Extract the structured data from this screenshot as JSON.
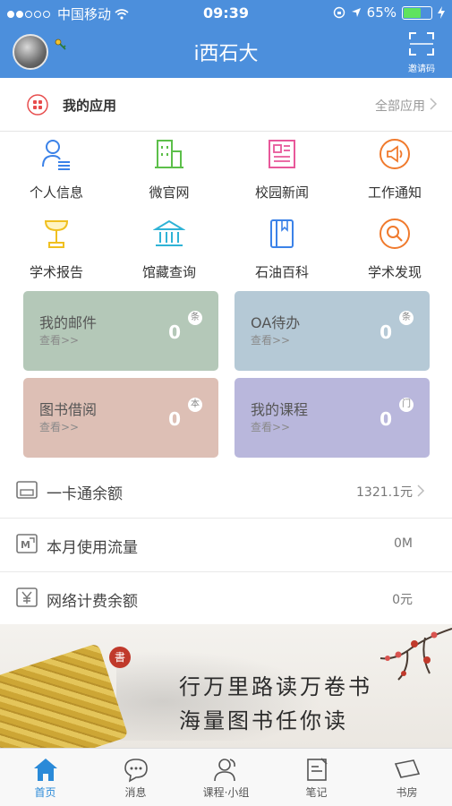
{
  "status_bar": {
    "carrier": "中国移动",
    "time": "09:39",
    "battery": "65%",
    "battery_level": 0.65
  },
  "header": {
    "title": "i西石大",
    "invite_label": "邀请码"
  },
  "my_apps": {
    "title": "我的应用",
    "all_label": "全部应用"
  },
  "apps": [
    {
      "label": "个人信息",
      "icon": "person-list-icon",
      "color": "#3b82e8"
    },
    {
      "label": "微官网",
      "icon": "building-icon",
      "color": "#5cbf4a"
    },
    {
      "label": "校园新闻",
      "icon": "newspaper-icon",
      "color": "#e8589a"
    },
    {
      "label": "工作通知",
      "icon": "megaphone-icon",
      "color": "#f07a2d"
    },
    {
      "label": "学术报告",
      "icon": "lamp-icon",
      "color": "#f0c020"
    },
    {
      "label": "馆藏查询",
      "icon": "library-icon",
      "color": "#2fb3d6"
    },
    {
      "label": "石油百科",
      "icon": "book-icon",
      "color": "#3b82e8"
    },
    {
      "label": "学术发现",
      "icon": "search-icon",
      "color": "#f07a2d"
    }
  ],
  "tiles": [
    {
      "title": "我的邮件",
      "sub": "查看>>",
      "count": "0",
      "badge": "条",
      "color": "#b4c8b8"
    },
    {
      "title": "OA待办",
      "sub": "查看>>",
      "count": "0",
      "badge": "条",
      "color": "#b5c9d6"
    },
    {
      "title": "图书借阅",
      "sub": "查看>>",
      "count": "0",
      "badge": "本",
      "color": "#ddbfb5"
    },
    {
      "title": "我的课程",
      "sub": "查看>>",
      "count": "0",
      "badge": "门",
      "color": "#b9b7dc"
    }
  ],
  "rows": [
    {
      "label": "一卡通余额",
      "value": "1321.1元"
    },
    {
      "label": "本月使用流量",
      "value": "0M"
    },
    {
      "label": "网络计费余额",
      "value": "0元"
    }
  ],
  "banner": {
    "seal": "書",
    "line1": "行万里路读万卷书",
    "line2": "海量图书任你读"
  },
  "tabs": [
    {
      "label": "首页",
      "icon": "home-icon",
      "active": true
    },
    {
      "label": "消息",
      "icon": "chat-icon",
      "active": false
    },
    {
      "label": "课程·小组",
      "icon": "group-icon",
      "active": false
    },
    {
      "label": "笔记",
      "icon": "note-icon",
      "active": false
    },
    {
      "label": "书房",
      "icon": "bookshelf-icon",
      "active": false
    }
  ]
}
